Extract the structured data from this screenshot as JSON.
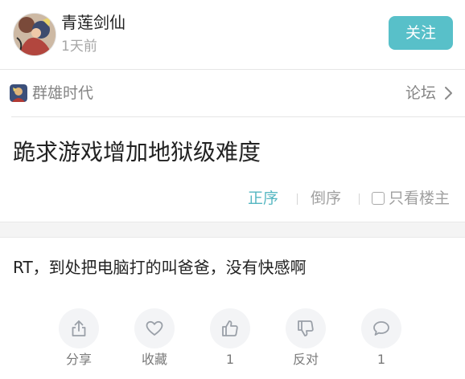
{
  "author": {
    "name": "青莲剑仙",
    "time": "1天前",
    "follow_label": "关注"
  },
  "forum": {
    "name": "群雄时代",
    "link_label": "论坛"
  },
  "post": {
    "title": "跪求游戏增加地狱级难度",
    "body": "RT，到处把电脑打的叫爸爸，没有快感啊"
  },
  "sort": {
    "ascending_label": "正序",
    "descending_label": "倒序",
    "host_only_label": "只看楼主"
  },
  "actions": {
    "share": {
      "label": "分享",
      "icon": "share-icon"
    },
    "favorite": {
      "label": "收藏",
      "icon": "heart-icon"
    },
    "like": {
      "label": "1",
      "icon": "thumbs-up-icon"
    },
    "oppose": {
      "label": "反对",
      "icon": "thumbs-down-icon"
    },
    "comment": {
      "label": "1",
      "icon": "comment-icon"
    }
  },
  "colors": {
    "accent": "#58c0c9",
    "active_sort": "#56b7c2",
    "muted_text": "#a0a0a0",
    "action_bg": "#f3f4f6"
  }
}
